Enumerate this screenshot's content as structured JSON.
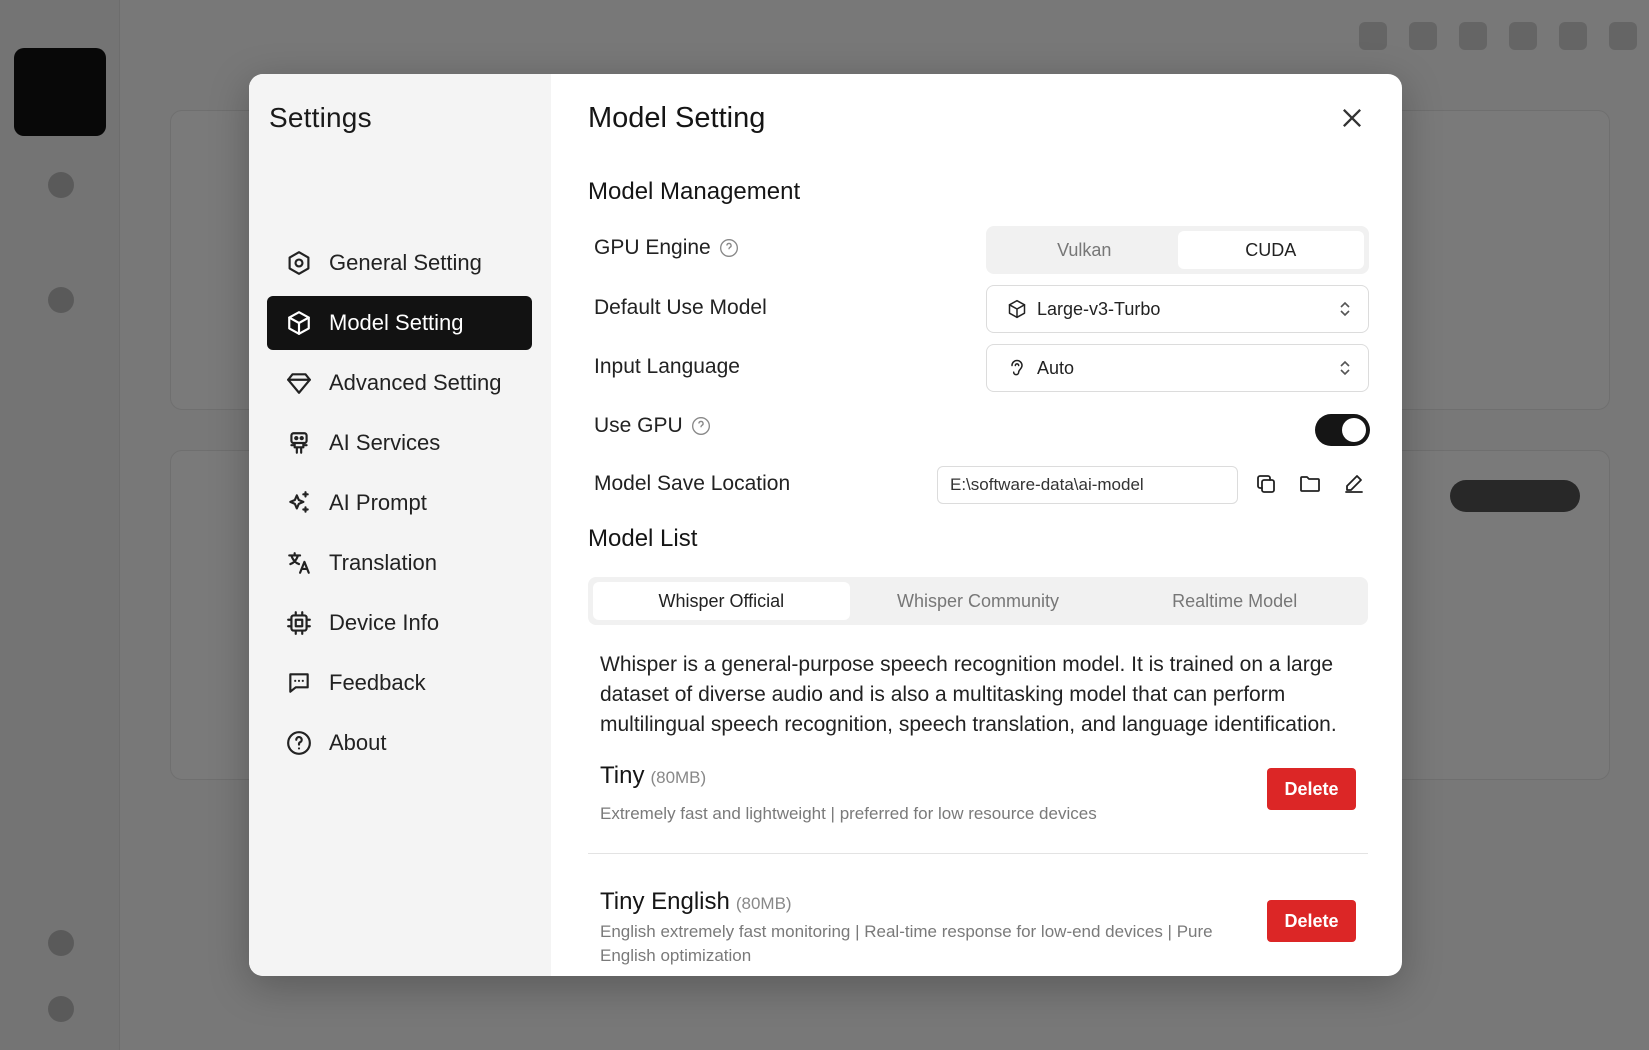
{
  "settings": {
    "title": "Settings",
    "nav": [
      {
        "label": "General Setting",
        "icon": "settings-hexagon-icon",
        "active": false
      },
      {
        "label": "Model Setting",
        "icon": "cube-icon",
        "active": true
      },
      {
        "label": "Advanced Setting",
        "icon": "diamond-icon",
        "active": false
      },
      {
        "label": "AI Services",
        "icon": "robot-icon",
        "active": false
      },
      {
        "label": "AI Prompt",
        "icon": "sparkles-icon",
        "active": false
      },
      {
        "label": "Translation",
        "icon": "translate-icon",
        "active": false
      },
      {
        "label": "Device Info",
        "icon": "cpu-icon",
        "active": false
      },
      {
        "label": "Feedback",
        "icon": "message-icon",
        "active": false
      },
      {
        "label": "About",
        "icon": "help-circle-icon",
        "active": false
      }
    ]
  },
  "panel": {
    "title": "Model Setting",
    "management": {
      "title": "Model Management",
      "gpu_engine": {
        "label": "GPU Engine",
        "options": [
          "Vulkan",
          "CUDA"
        ],
        "selected": "CUDA"
      },
      "default_model": {
        "label": "Default Use Model",
        "value": "Large-v3-Turbo"
      },
      "input_language": {
        "label": "Input Language",
        "value": "Auto"
      },
      "use_gpu": {
        "label": "Use GPU",
        "enabled": true
      },
      "save_location": {
        "label": "Model Save Location",
        "value": "E:\\software-data\\ai-model"
      }
    },
    "model_list": {
      "title": "Model List",
      "tabs": [
        "Whisper Official",
        "Whisper Community",
        "Realtime Model"
      ],
      "selected_tab": "Whisper Official",
      "description": "Whisper is a general-purpose speech recognition model. It is trained on a large dataset of diverse audio and is also a multitasking model that can perform multilingual speech recognition, speech translation, and language identification.",
      "models": [
        {
          "name": "Tiny",
          "size": "(80MB)",
          "desc": "Extremely fast and lightweight | preferred for low resource devices",
          "action": "Delete"
        },
        {
          "name": "Tiny English",
          "size": "(80MB)",
          "desc": "English extremely fast monitoring | Real-time response for low-end devices | Pure English optimization",
          "action": "Delete"
        }
      ]
    }
  },
  "colors": {
    "accent": "#121212",
    "danger": "#dc2626",
    "sidebar_bg": "#f4f4f4"
  }
}
